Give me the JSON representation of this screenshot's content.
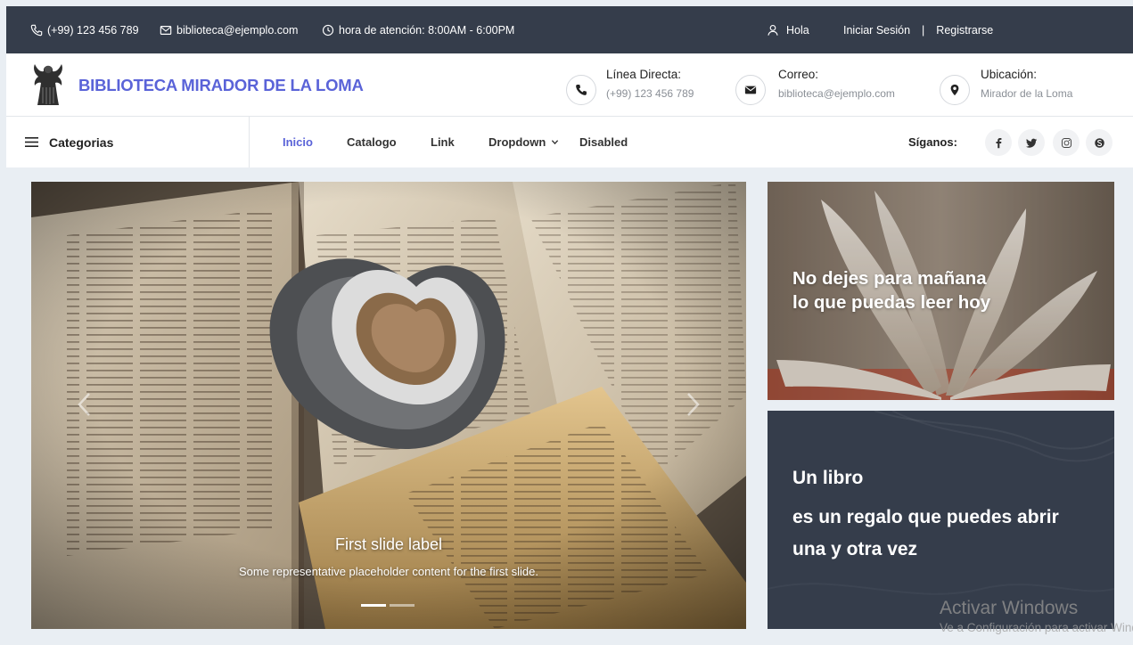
{
  "topbar": {
    "phone": "(+99) 123 456 789",
    "email": "biblioteca@ejemplo.com",
    "hours": "hora de atención: 8:00AM - 6:00PM",
    "greeting": "Hola",
    "login": "Iniciar Sesión",
    "divider": "|",
    "register": "Registrarse"
  },
  "header": {
    "brand": "BIBLIOTECA MIRADOR DE LA LOMA",
    "contacts": [
      {
        "title": "Línea Directa:",
        "value": "(+99) 123 456 789",
        "icon": "phone-icon"
      },
      {
        "title": "Correo:",
        "value": "biblioteca@ejemplo.com",
        "icon": "envelope-icon"
      },
      {
        "title": "Ubicación:",
        "value": "Mirador de la Loma",
        "icon": "map-marker-icon"
      }
    ]
  },
  "nav": {
    "categories_label": "Categorias",
    "links": [
      {
        "label": "Inicio",
        "active": true
      },
      {
        "label": "Catalogo"
      },
      {
        "label": "Link"
      },
      {
        "label": "Dropdown"
      },
      {
        "label": "Disabled"
      }
    ],
    "follow_label": "Síganos:",
    "social": [
      "facebook-icon",
      "twitter-icon",
      "instagram-icon",
      "skype-icon"
    ]
  },
  "carousel": {
    "slide_title": "First slide label",
    "slide_text": "Some representative placeholder content for the first slide.",
    "indicator_count": 2,
    "active_index": 0
  },
  "promo1": {
    "line1": "No dejes para mañana",
    "line2": "lo que puedas leer hoy"
  },
  "promo2": {
    "line1": "Un libro",
    "line2": "es un regalo que puedes abrir",
    "line3": "una y otra vez"
  },
  "watermark": {
    "title": "Activar Windows",
    "subtitle": "Ve a Configuración para activar Windows."
  },
  "colors": {
    "topbar_bg": "#353d4b",
    "brand": "#5a63d8",
    "page_bg": "#e9eef3"
  }
}
